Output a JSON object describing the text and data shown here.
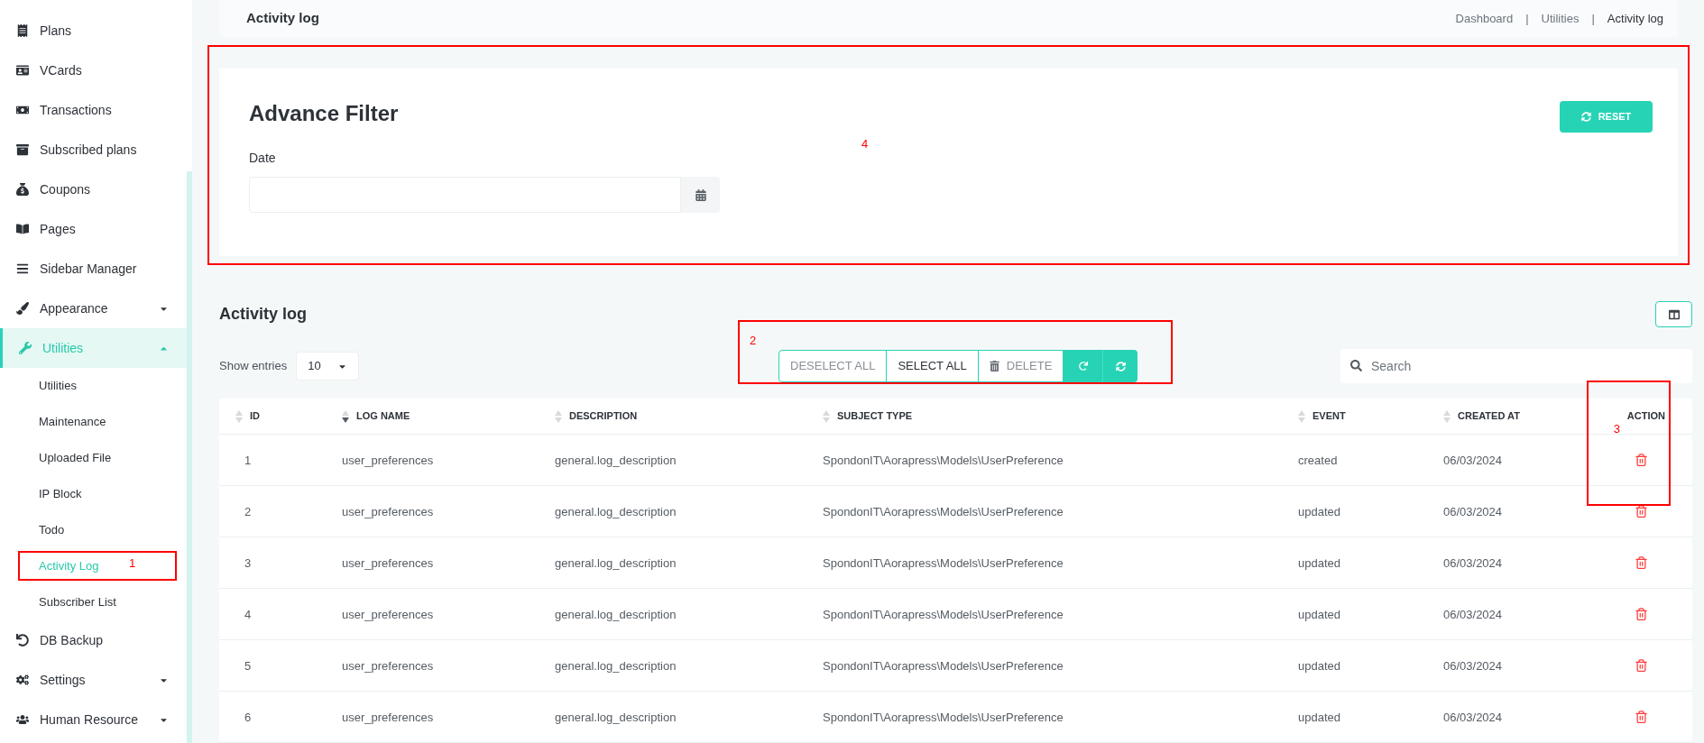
{
  "sidebar": {
    "items": [
      {
        "label": "Plans",
        "expandable": false,
        "selected": false
      },
      {
        "label": "VCards",
        "expandable": false,
        "selected": false
      },
      {
        "label": "Transactions",
        "expandable": false,
        "selected": false
      },
      {
        "label": "Subscribed plans",
        "expandable": false,
        "selected": false
      },
      {
        "label": "Coupons",
        "expandable": false,
        "selected": false
      },
      {
        "label": "Pages",
        "expandable": false,
        "selected": false
      },
      {
        "label": "Sidebar Manager",
        "expandable": false,
        "selected": false
      },
      {
        "label": "Appearance",
        "expandable": true,
        "expanded": false,
        "selected": false
      },
      {
        "label": "Utilities",
        "expandable": true,
        "expanded": true,
        "selected": true,
        "children": [
          {
            "label": "Utilities",
            "selected": false
          },
          {
            "label": "Maintenance",
            "selected": false
          },
          {
            "label": "Uploaded File",
            "selected": false
          },
          {
            "label": "IP Block",
            "selected": false
          },
          {
            "label": "Todo",
            "selected": false
          },
          {
            "label": "Activity Log",
            "selected": true,
            "annotation": "1"
          },
          {
            "label": "Subscriber List",
            "selected": false
          }
        ]
      },
      {
        "label": "DB Backup",
        "expandable": false,
        "selected": false
      },
      {
        "label": "Settings",
        "expandable": true,
        "expanded": false,
        "selected": false
      },
      {
        "label": "Human Resource",
        "expandable": true,
        "expanded": false,
        "selected": false
      }
    ]
  },
  "header": {
    "title": "Activity log",
    "breadcrumb": [
      {
        "kind": "link",
        "label": "Dashboard"
      },
      {
        "kind": "separator",
        "label": "|"
      },
      {
        "kind": "link",
        "label": "Utilities"
      },
      {
        "kind": "separator",
        "label": "|"
      },
      {
        "kind": "current",
        "label": "Activity log"
      }
    ]
  },
  "filter": {
    "title": "Advance Filter",
    "annotation": "4",
    "reset_button": "RESET",
    "date_label": "Date"
  },
  "log": {
    "title": "Activity log",
    "show_entries_label": "Show entries",
    "entries_value": "10",
    "search_placeholder": "Search",
    "bulk_actions": {
      "annotation": "2",
      "buttons": [
        {
          "kind": "text",
          "label": "DESELECT ALL",
          "active": false
        },
        {
          "kind": "text",
          "label": "SELECT ALL",
          "active": true
        },
        {
          "kind": "delete",
          "label": "DELETE",
          "active": false
        },
        {
          "kind": "undo"
        },
        {
          "kind": "sync"
        }
      ]
    },
    "action_annotation": "3",
    "columns": [
      {
        "label": "ID",
        "sortable": true,
        "sorted_desc": false
      },
      {
        "label": "LOG NAME",
        "sortable": true,
        "sorted_desc": true
      },
      {
        "label": "DESCRIPTION",
        "sortable": true,
        "sorted_desc": false
      },
      {
        "label": "SUBJECT TYPE",
        "sortable": true,
        "sorted_desc": false
      },
      {
        "label": "EVENT",
        "sortable": true,
        "sorted_desc": false
      },
      {
        "label": "CREATED AT",
        "sortable": true,
        "sorted_desc": false
      },
      {
        "label": "ACTION",
        "sortable": false
      }
    ],
    "rows": [
      {
        "id": "1",
        "log_name": "user_preferences",
        "description": "general.log_description",
        "subject_type": "SpondonIT\\Aorapress\\Models\\UserPreference",
        "event": "created",
        "created_at": "06/03/2024"
      },
      {
        "id": "2",
        "log_name": "user_preferences",
        "description": "general.log_description",
        "subject_type": "SpondonIT\\Aorapress\\Models\\UserPreference",
        "event": "updated",
        "created_at": "06/03/2024"
      },
      {
        "id": "3",
        "log_name": "user_preferences",
        "description": "general.log_description",
        "subject_type": "SpondonIT\\Aorapress\\Models\\UserPreference",
        "event": "updated",
        "created_at": "06/03/2024"
      },
      {
        "id": "4",
        "log_name": "user_preferences",
        "description": "general.log_description",
        "subject_type": "SpondonIT\\Aorapress\\Models\\UserPreference",
        "event": "updated",
        "created_at": "06/03/2024"
      },
      {
        "id": "5",
        "log_name": "user_preferences",
        "description": "general.log_description",
        "subject_type": "SpondonIT\\Aorapress\\Models\\UserPreference",
        "event": "updated",
        "created_at": "06/03/2024"
      },
      {
        "id": "6",
        "log_name": "user_preferences",
        "description": "general.log_description",
        "subject_type": "SpondonIT\\Aorapress\\Models\\UserPreference",
        "event": "updated",
        "created_at": "06/03/2024"
      }
    ]
  }
}
